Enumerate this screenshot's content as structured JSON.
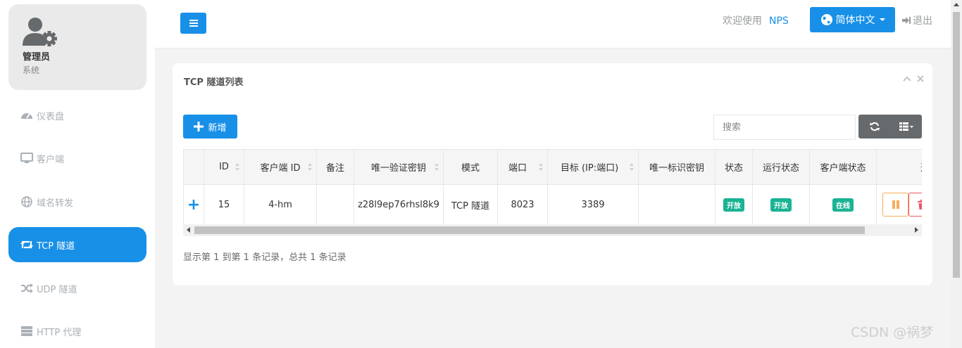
{
  "sidebar": {
    "profile": {
      "name": "管理员",
      "role": "系统"
    },
    "items": [
      {
        "label": "仪表盘",
        "icon": "dashboard-icon",
        "active": false
      },
      {
        "label": "客户端",
        "icon": "desktop-icon",
        "active": false
      },
      {
        "label": "域名转发",
        "icon": "globe-icon",
        "active": false
      },
      {
        "label": "TCP 隧道",
        "icon": "retweet-icon",
        "active": true
      },
      {
        "label": "UDP 隧道",
        "icon": "shuffle-icon",
        "active": false
      },
      {
        "label": "HTTP 代理",
        "icon": "server-icon",
        "active": false
      }
    ]
  },
  "topbar": {
    "welcome": "欢迎使用",
    "brand": "NPS",
    "language": "简体中文",
    "logout": "退出"
  },
  "card": {
    "title": "TCP 隧道列表",
    "add_label": "新增",
    "search_placeholder": "搜索"
  },
  "table": {
    "headers": [
      "",
      "ID",
      "客户端 ID",
      "备注",
      "唯一验证密钥",
      "模式",
      "端口",
      "目标 (IP:端口)",
      "唯一标识密钥",
      "状态",
      "运行状态",
      "客户端状态",
      "选"
    ],
    "rows": [
      {
        "id": "15",
        "client_id": "4-hm",
        "remark": "",
        "verify_key": "z28l9ep76rhsl8k9",
        "mode": "TCP 隧道",
        "port": "8023",
        "target": "3389",
        "unique_key": "",
        "status": "开放",
        "run_status": "开放",
        "client_status": "在线"
      }
    ]
  },
  "pagination": {
    "summary": "显示第 1 到第 1 条记录，总共 1 条记录"
  },
  "watermark": "CSDN @祸梦",
  "colors": {
    "primary": "#1890e8",
    "success": "#1ab394",
    "warning": "#f8ac59",
    "danger": "#ed5565"
  }
}
